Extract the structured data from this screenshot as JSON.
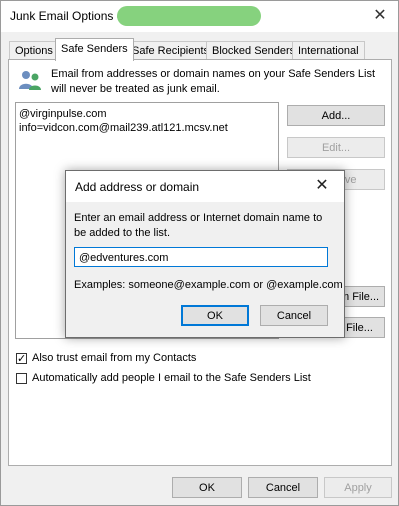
{
  "window": {
    "title": "Junk Email Options -",
    "close_glyph": "✕"
  },
  "tabs": [
    {
      "label": "Options"
    },
    {
      "label": "Safe Senders"
    },
    {
      "label": "Safe Recipients"
    },
    {
      "label": "Blocked Senders"
    },
    {
      "label": "International"
    }
  ],
  "active_tab": "Safe Senders",
  "safe_senders": {
    "description": "Email from addresses or domain names on your Safe Senders List will never be treated as junk email.",
    "list": [
      "@virginpulse.com",
      "info=vidcon.com@mail239.atl121.mcsv.net"
    ],
    "buttons": {
      "add": "Add...",
      "edit": "Edit...",
      "remove": "Remove",
      "import": "Import from File...",
      "export": "Export to File..."
    },
    "checkboxes": [
      {
        "label": "Also trust email from my Contacts",
        "checked": true
      },
      {
        "label": "Automatically add people I email to the Safe Senders List",
        "checked": false
      }
    ]
  },
  "footer": {
    "ok": "OK",
    "cancel": "Cancel",
    "apply": "Apply"
  },
  "dialog": {
    "title": "Add address or domain",
    "close_glyph": "✕",
    "prompt": "Enter an email address or Internet domain name to be added to the list.",
    "input_value": "@edventures.com",
    "examples": "Examples: someone@example.com or @example.com",
    "ok": "OK",
    "cancel": "Cancel"
  },
  "icons": {
    "people": "people-icon",
    "check": "✓"
  },
  "colors": {
    "accent": "#0078d7",
    "title_redaction": "#86d27e"
  }
}
